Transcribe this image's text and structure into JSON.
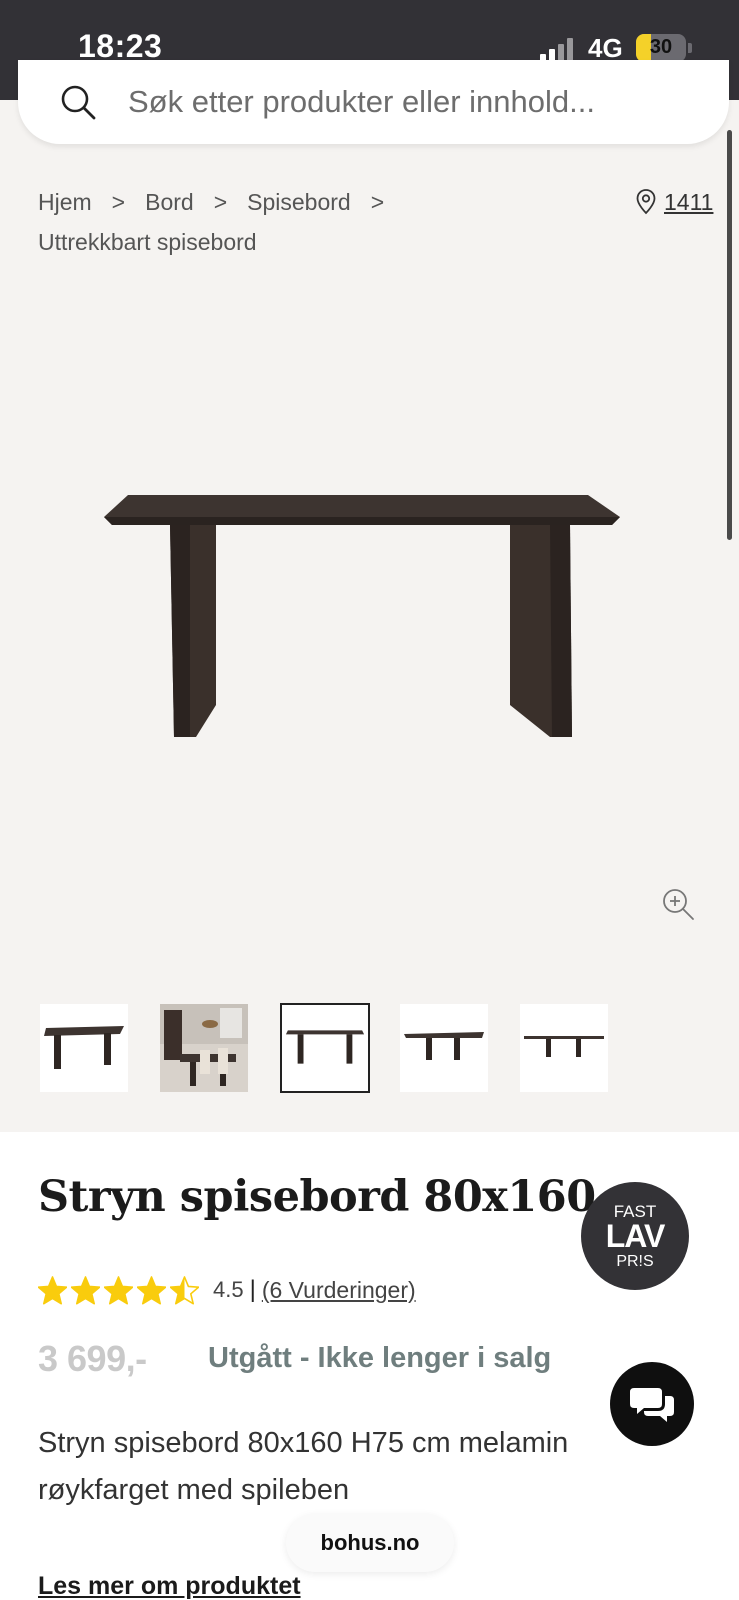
{
  "status_bar": {
    "time": "18:23",
    "network": "4G",
    "battery": "30",
    "battery_level": 0.3
  },
  "search": {
    "placeholder": "Søk etter produkter eller innhold..."
  },
  "breadcrumb": {
    "items": [
      "Hjem",
      "Bord",
      "Spisebord",
      "Uttrekkbart spisebord"
    ],
    "separator": ">"
  },
  "store": {
    "label": "1411"
  },
  "product": {
    "title": "Stryn spisebord 80x160",
    "badge": {
      "line1": "FAST",
      "line2": "LAV",
      "line3": "PR!S"
    },
    "rating_value": "4.5",
    "rating_separator": "|",
    "rating_count": "(6 Vurderinger)",
    "rating_fraction": 0.9,
    "price": "3 699,-",
    "status": "Utgått - Ikke lenger i salg",
    "description": "Stryn spisebord 80x160 H75 cm melamin røykfarget med spileben",
    "read_more": "Les mer om produktet"
  },
  "footer": {
    "url": "bohus.no"
  },
  "colors": {
    "status_bar_bg": "#323136",
    "page_bg": "#f5f3f1",
    "star": "#f9cc0d",
    "price": "#c9c9c9",
    "status_text": "#6f7e7e",
    "badge_bg": "#333236",
    "table_wood": "#3d3430"
  },
  "icons": [
    "search-icon",
    "location-pin-icon",
    "zoom-in-icon",
    "star-icon",
    "chat-icon",
    "chevron-right-icon"
  ]
}
